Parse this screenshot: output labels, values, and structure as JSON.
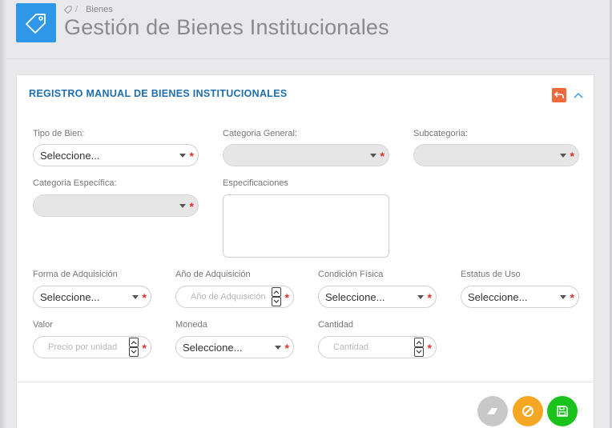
{
  "header": {
    "breadcrumb": "Bienes",
    "breadcrumb_sep": "/",
    "title": "Gestión de Bienes Institucionales",
    "icon": "tag-icon",
    "icon_color": "#2f97e8"
  },
  "panel": {
    "title": "REGISTRO MANUAL DE BIENES INSTITUCIONALES",
    "back_icon": "back-arrow-icon",
    "back_color": "#f0693a",
    "collapse_icon": "chevron-up-icon",
    "title_color": "#1f6fb0"
  },
  "form": {
    "tipo_bien": {
      "label": "Tipo de Bien:",
      "value": "Seleccione..."
    },
    "categoria_general": {
      "label": "Categoria General:",
      "value": ""
    },
    "subcategoria": {
      "label": "Subcategoria:",
      "value": ""
    },
    "categoria_especifica": {
      "label": "Categoria Específica:",
      "value": ""
    },
    "especificaciones": {
      "label": "Especificaciones",
      "value": ""
    },
    "forma_adquisicion": {
      "label": "Forma de Adquisición",
      "value": "Seleccione..."
    },
    "anio_adquisicion": {
      "label": "Año de Adquisición",
      "placeholder": "Año de Adquisición"
    },
    "condicion_fisica": {
      "label": "Condición Física",
      "value": "Seleccione..."
    },
    "estatus_uso": {
      "label": "Estatus de Uso",
      "value": "Seleccione..."
    },
    "valor": {
      "label": "Valor",
      "placeholder": "Precio por unidad"
    },
    "moneda": {
      "label": "Moneda",
      "value": "Seleccione..."
    },
    "cantidad": {
      "label": "Cantidad",
      "placeholder": "Cantidad"
    },
    "required_mark": "*"
  },
  "actions": {
    "clear": {
      "icon": "eraser-icon",
      "color": "#c8c8c8"
    },
    "cancel": {
      "icon": "ban-icon",
      "color": "#f5a623"
    },
    "save": {
      "icon": "save-icon",
      "color": "#1cc21c"
    }
  }
}
